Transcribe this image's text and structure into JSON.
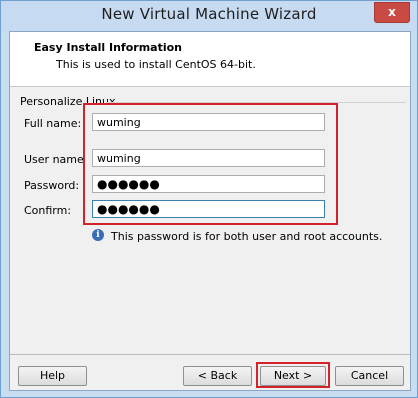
{
  "window": {
    "title": "New Virtual Machine Wizard",
    "close_glyph": "x"
  },
  "header": {
    "title": "Easy Install Information",
    "subtitle": "This is used to install CentOS 64-bit."
  },
  "group": {
    "label": "Personalize Linux"
  },
  "fields": {
    "full_name": {
      "label": "Full name:",
      "value": "wuming"
    },
    "user_name": {
      "label": "User name",
      "value": "wuming"
    },
    "password": {
      "label": "Password:",
      "value": "●●●●●●"
    },
    "confirm": {
      "label": "Confirm:",
      "value": "●●●●●●"
    }
  },
  "info": {
    "icon": "info-icon",
    "icon_glyph": "i",
    "text": "This password is for both user and root accounts."
  },
  "buttons": {
    "help": "Help",
    "back": "< Back",
    "next": "Next >",
    "cancel": "Cancel"
  },
  "colors": {
    "highlight_border": "#d2232a",
    "titlebar": "#c6dbf1",
    "close_button": "#c94a43"
  }
}
